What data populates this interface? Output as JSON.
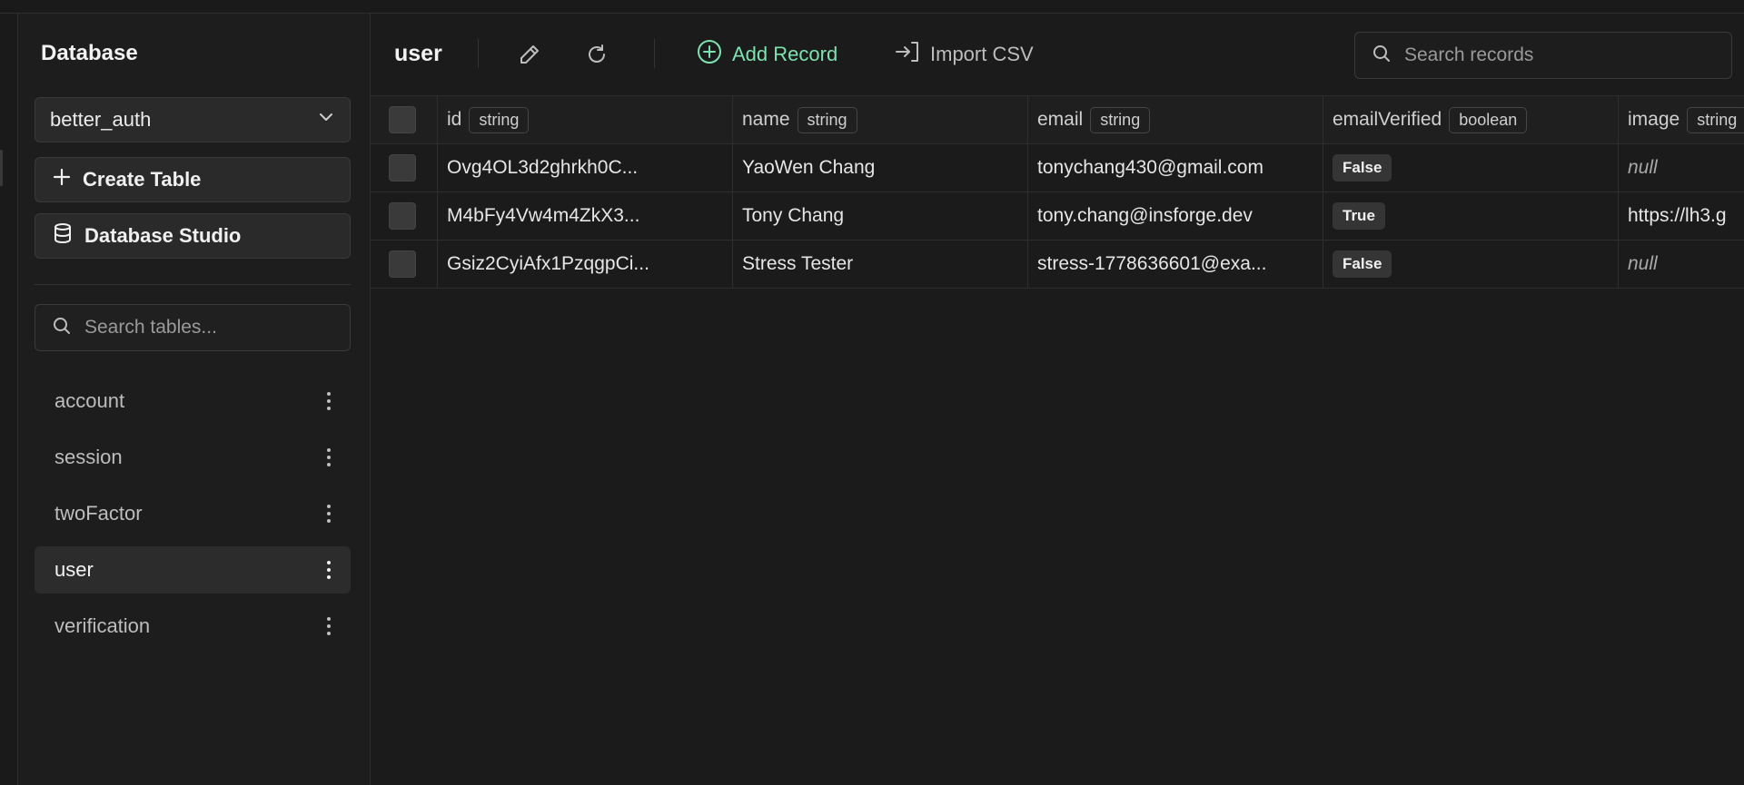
{
  "sidebar": {
    "title": "Database",
    "database_select": {
      "value": "better_auth"
    },
    "create_table_label": "Create Table",
    "database_studio_label": "Database Studio",
    "search_placeholder": "Search tables...",
    "tables": [
      {
        "label": "account",
        "active": false
      },
      {
        "label": "session",
        "active": false
      },
      {
        "label": "twoFactor",
        "active": false
      },
      {
        "label": "user",
        "active": true
      },
      {
        "label": "verification",
        "active": false
      }
    ]
  },
  "toolbar": {
    "title": "user",
    "add_record_label": "Add Record",
    "import_csv_label": "Import CSV",
    "search_placeholder": "Search records"
  },
  "table": {
    "columns": [
      {
        "name": "id",
        "type": "string"
      },
      {
        "name": "name",
        "type": "string"
      },
      {
        "name": "email",
        "type": "string"
      },
      {
        "name": "emailVerified",
        "type": "boolean"
      },
      {
        "name": "image",
        "type": "string"
      }
    ],
    "rows": [
      {
        "id": "Ovg4OL3d2ghrkh0C...",
        "name": "YaoWen Chang",
        "email": "tonychang430@gmail.com",
        "emailVerified": "False",
        "image": "null"
      },
      {
        "id": "M4bFy4Vw4m4ZkX3...",
        "name": "Tony Chang",
        "email": "tony.chang@insforge.dev",
        "emailVerified": "True",
        "image": "https://lh3.g"
      },
      {
        "id": "Gsiz2CyiAfx1PzqgpCi...",
        "name": "Stress Tester",
        "email": "stress-1778636601@exa...",
        "emailVerified": "False",
        "image": "null"
      }
    ]
  },
  "colors": {
    "accent_green": "#7ee2b0",
    "background": "#1b1b1b",
    "sidebar_bg": "#1d1d1d",
    "border": "#2e2e2e"
  }
}
